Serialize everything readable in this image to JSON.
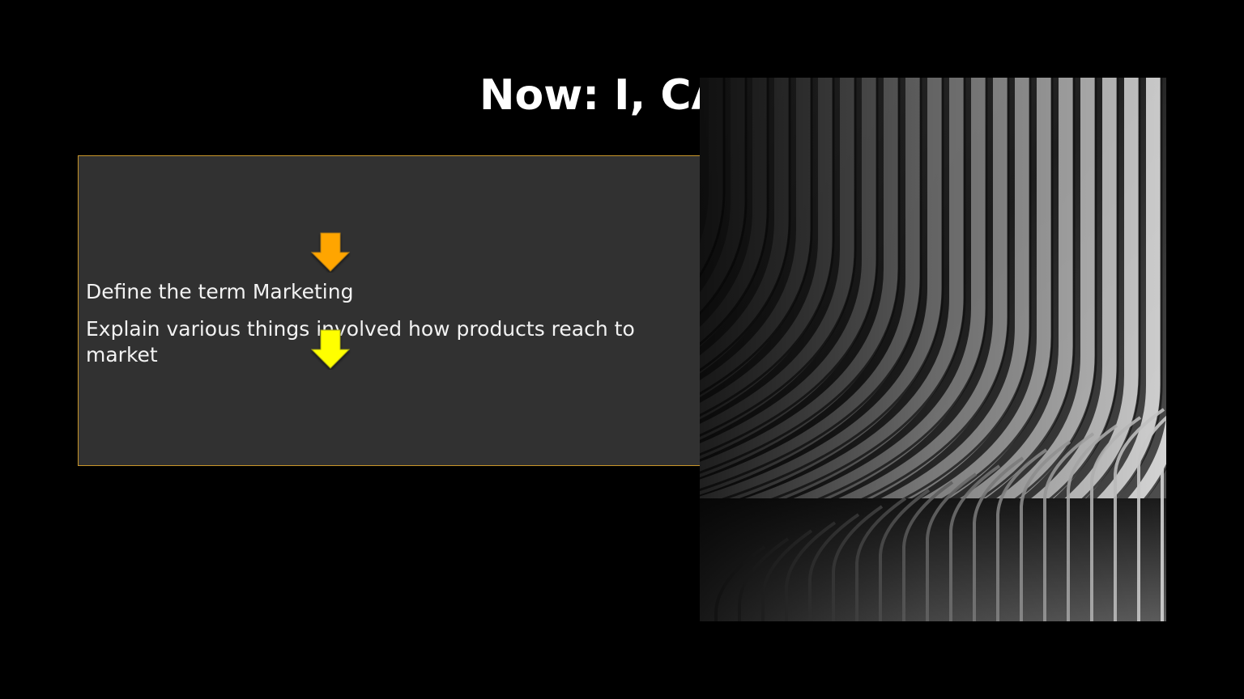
{
  "slide": {
    "title": "Now: I, CAN",
    "objectives": [
      "Define the term Marketing",
      "Explain various things involved how products reach to market"
    ]
  },
  "icons": {
    "first_arrow": "down-arrow-icon",
    "second_arrow": "down-arrow-icon"
  },
  "colors": {
    "background": "#000000",
    "box_fill": "#313131",
    "box_border": "#c9962a",
    "arrow_orange": "#ffa500",
    "arrow_yellow": "#ffff00",
    "text": "#ffffff"
  },
  "image": {
    "name": "architectural-ribs-photo"
  }
}
